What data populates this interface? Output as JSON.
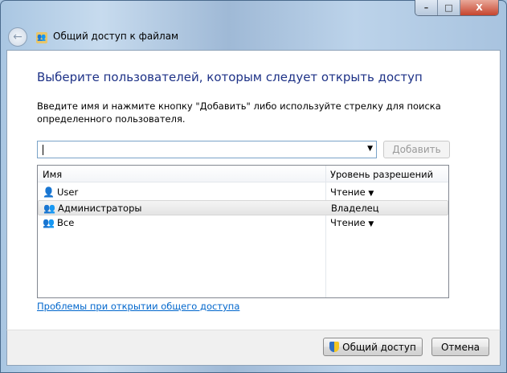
{
  "window": {
    "title": "Общий доступ к файлам",
    "minimize": "–",
    "maximize": "□",
    "close": "X"
  },
  "heading": "Выберите пользователей, которым следует открыть доступ",
  "instruction": "Введите имя и нажмите кнопку \"Добавить\" либо используйте стрелку для поиска определенного пользователя.",
  "combo": {
    "value": ""
  },
  "add_button": "Добавить",
  "list": {
    "columns": [
      "Имя",
      "Уровень разрешений"
    ],
    "rows": [
      {
        "name": "User",
        "permission": "Чтение",
        "icon": "user-icon",
        "dropdown": true
      },
      {
        "name": "Администраторы",
        "permission": "Владелец",
        "icon": "group-icon",
        "dropdown": false
      },
      {
        "name": "Все",
        "permission": "Чтение",
        "icon": "group-icon",
        "dropdown": true
      }
    ]
  },
  "help_link": "Проблемы при открытии общего доступа",
  "footer": {
    "share_button": "Общий доступ",
    "cancel_button": "Отмена"
  }
}
